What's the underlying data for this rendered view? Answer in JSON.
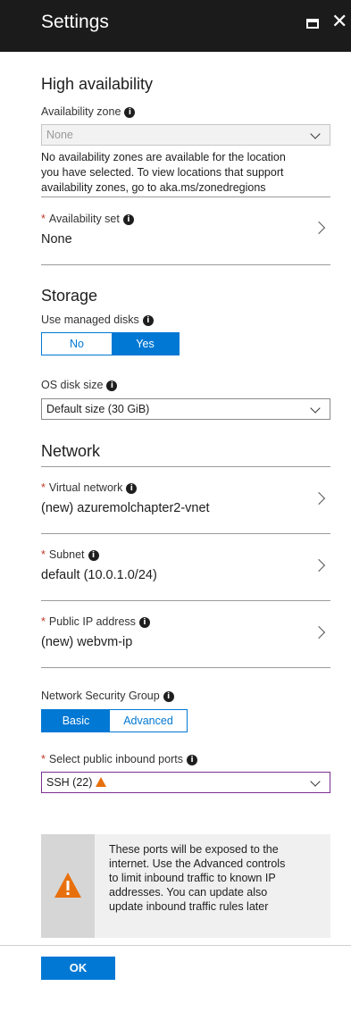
{
  "header": {
    "title": "Settings"
  },
  "high_availability": {
    "title": "High availability",
    "zone_label": "Availability zone",
    "zone_value": "None",
    "zone_note_1": "No availability zones are available for the location",
    "zone_note_2": "you have selected. To view locations that support",
    "zone_note_3": "availability zones, go to aka.ms/zonedregions",
    "set_label": "Availability set",
    "set_value": "None"
  },
  "storage": {
    "title": "Storage",
    "managed_label": "Use managed disks",
    "managed_no": "No",
    "managed_yes": "Yes",
    "managed_selected": "Yes",
    "os_disk_label": "OS disk size",
    "os_disk_value": "Default size (30 GiB)"
  },
  "network": {
    "title": "Network",
    "vnet_label": "Virtual network",
    "vnet_value": "(new) azuremolchapter2-vnet",
    "subnet_label": "Subnet",
    "subnet_value": "default (10.0.1.0/24)",
    "pip_label": "Public IP address",
    "pip_value": "(new) webvm-ip",
    "nsg_label": "Network Security Group",
    "nsg_basic": "Basic",
    "nsg_advanced": "Advanced",
    "nsg_selected": "Basic",
    "ports_label": "Select public inbound ports",
    "ports_value": "SSH (22)"
  },
  "callout": {
    "line1": "These ports will be exposed to the",
    "line2": "internet. Use the Advanced controls",
    "line3": "to limit inbound traffic to known IP",
    "line4": "addresses. You can update also",
    "line5": "update inbound traffic rules later"
  },
  "footer": {
    "ok_label": "OK"
  },
  "colors": {
    "accent": "#0078d4",
    "header_bg": "#1b1b1b",
    "warning": "#e8700c",
    "required": "#c0392b"
  }
}
